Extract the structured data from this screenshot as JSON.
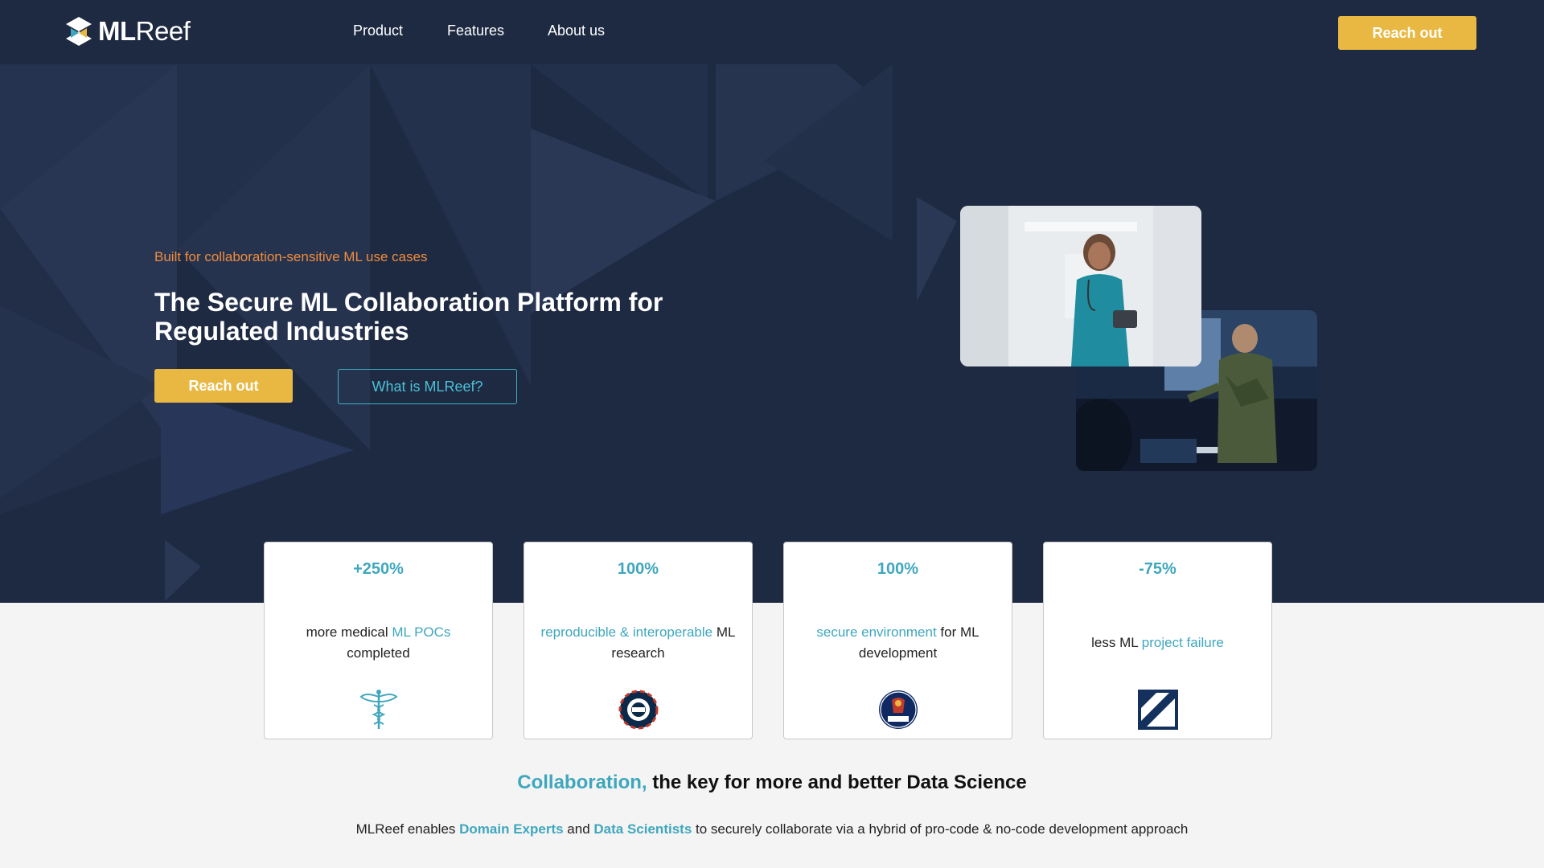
{
  "nav": {
    "logo_bold": "ML",
    "logo_light": "Reef",
    "links": [
      "Product",
      "Features",
      "About us"
    ],
    "cta": "Reach out"
  },
  "hero": {
    "eyebrow": "Built for collaboration-sensitive ML use cases",
    "title": "The Secure ML Collaboration Platform for Regulated Industries",
    "primary_button": "Reach out",
    "secondary_button": "What is MLReef?"
  },
  "stats": [
    {
      "value": "+250%",
      "pre": "more medical ",
      "highlight": "ML POCs",
      "post": " completed",
      "icon": "caduceus-icon"
    },
    {
      "value": "100%",
      "pre": "",
      "highlight": "reproducible & interoperable",
      "post": " ML research",
      "icon": "esa-logo-icon"
    },
    {
      "value": "100%",
      "pre": "",
      "highlight": "secure environment",
      "post": " for ML development",
      "icon": "saab-logo-icon"
    },
    {
      "value": "-75%",
      "pre": "less ML ",
      "highlight": "project failure",
      "post": "",
      "icon": "square-slash-logo-icon"
    }
  ],
  "section": {
    "title_highlight": "Collaboration,",
    "title_rest": " the key for more and better Data Science",
    "text_1": "MLReef enables ",
    "text_hl1": "Domain Experts",
    "text_2": " and ",
    "text_hl2": "Data Scientists",
    "text_3": " to securely collaborate via a hybrid of pro-code & no-code development approach"
  },
  "colors": {
    "hero_bg": "#1e2a42",
    "accent_yellow": "#e9b842",
    "accent_teal": "#3fa7bd",
    "eyebrow_orange": "#f08c3c"
  }
}
